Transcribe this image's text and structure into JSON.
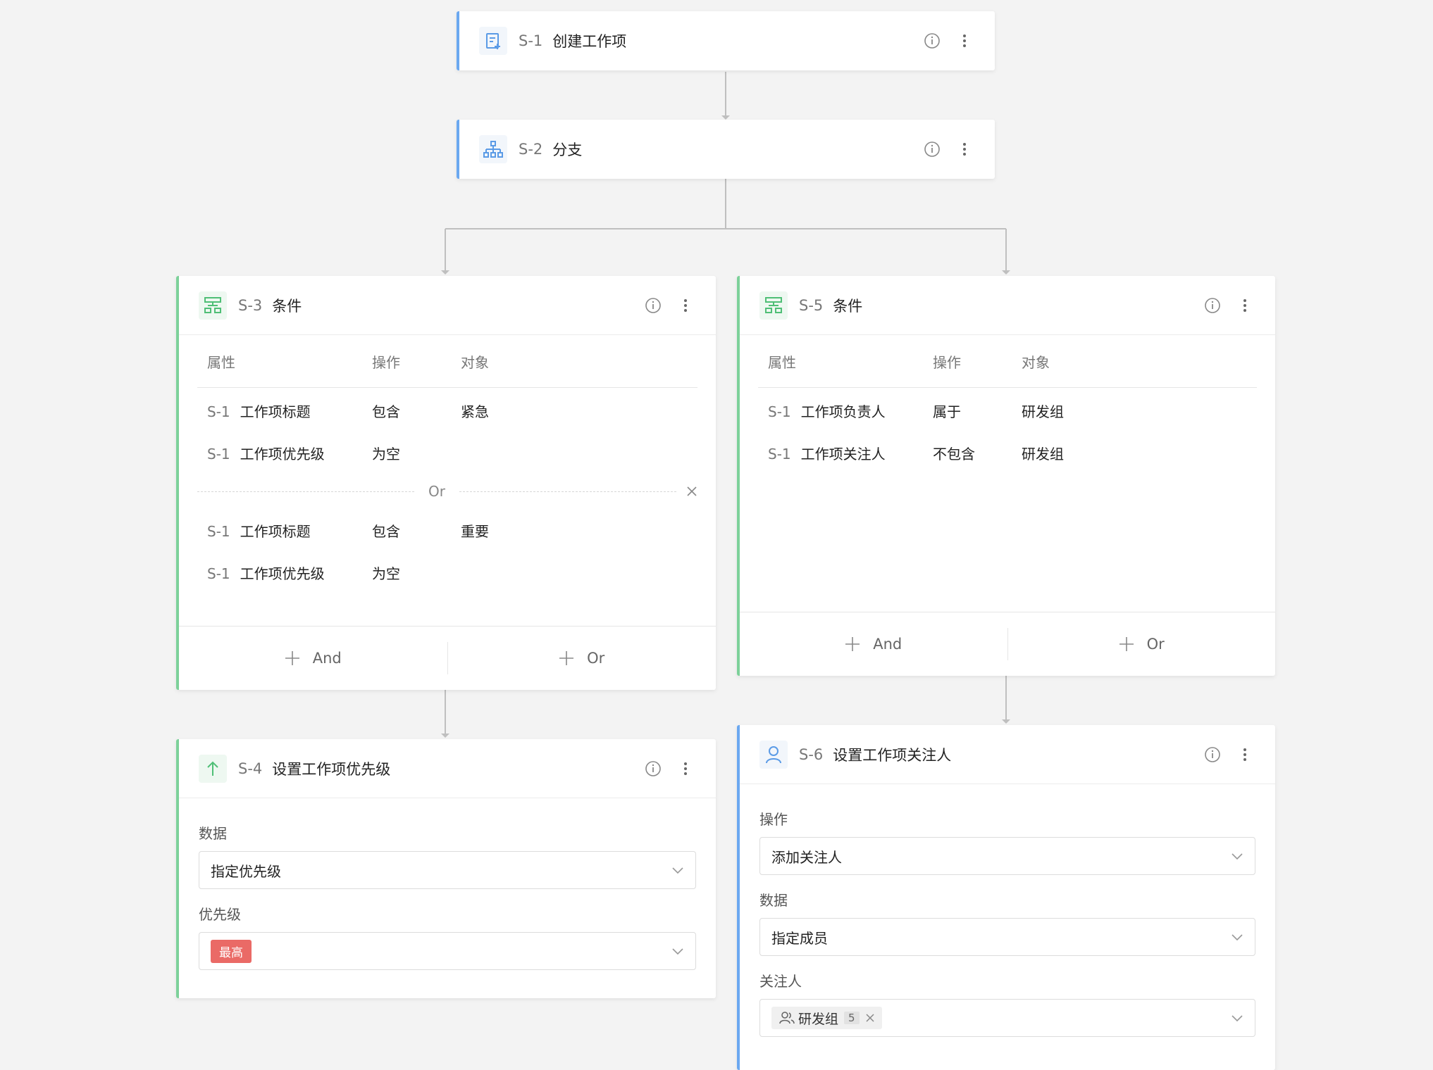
{
  "steps": {
    "s1": {
      "id": "S-1",
      "title": "创建工作项",
      "icon": "create-workitem-icon"
    },
    "s2": {
      "id": "S-2",
      "title": "分支",
      "icon": "branch-icon"
    },
    "s3": {
      "id": "S-3",
      "title": "条件",
      "icon": "condition-icon",
      "headers": [
        "属性",
        "操作",
        "对象"
      ],
      "group1": [
        {
          "sid": "S-1",
          "attr": "工作项标题",
          "op": "包含",
          "obj": "紧急"
        },
        {
          "sid": "S-1",
          "attr": "工作项优先级",
          "op": "为空",
          "obj": ""
        }
      ],
      "or_label": "Or",
      "group2": [
        {
          "sid": "S-1",
          "attr": "工作项标题",
          "op": "包含",
          "obj": "重要"
        },
        {
          "sid": "S-1",
          "attr": "工作项优先级",
          "op": "为空",
          "obj": ""
        }
      ],
      "and_btn": "And",
      "or_btn": "Or"
    },
    "s4": {
      "id": "S-4",
      "title": "设置工作项优先级",
      "icon": "arrow-up-icon",
      "data_label": "数据",
      "data_value": "指定优先级",
      "priority_label": "优先级",
      "priority_value": "最高"
    },
    "s5": {
      "id": "S-5",
      "title": "条件",
      "icon": "condition-icon",
      "headers": [
        "属性",
        "操作",
        "对象"
      ],
      "rows": [
        {
          "sid": "S-1",
          "attr": "工作项负责人",
          "op": "属于",
          "obj": "研发组"
        },
        {
          "sid": "S-1",
          "attr": "工作项关注人",
          "op": "不包含",
          "obj": "研发组"
        }
      ],
      "and_btn": "And",
      "or_btn": "Or"
    },
    "s6": {
      "id": "S-6",
      "title": "设置工作项关注人",
      "icon": "user-icon",
      "op_label": "操作",
      "op_value": "添加关注人",
      "data_label": "数据",
      "data_value": "指定成员",
      "watcher_label": "关注人",
      "watcher_chip": "研发组",
      "watcher_count": "5"
    }
  },
  "colors": {
    "blue": "#6ba8f0",
    "green": "#7dd19a",
    "danger": "#ea6a66"
  }
}
